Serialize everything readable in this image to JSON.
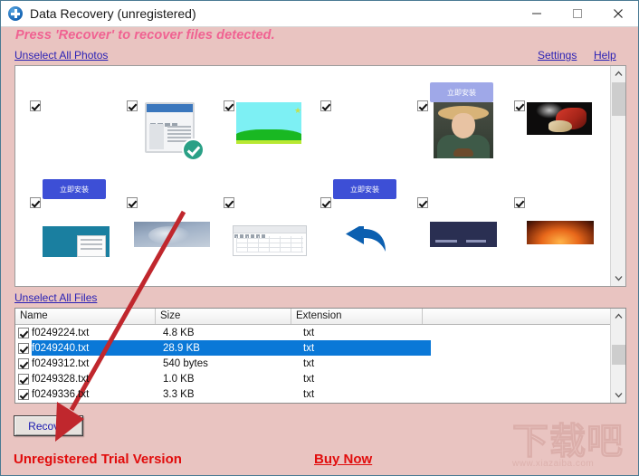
{
  "window": {
    "title": "Data Recovery (unregistered)",
    "icon": "app-plus-circle-icon",
    "minimize_label": "–",
    "maximize_label": "□",
    "close_label": "✕"
  },
  "banner": {
    "message": "Press 'Recover' to recover files detected."
  },
  "links": {
    "unselect_photos": "Unselect All Photos",
    "unselect_files": "Unselect All Files",
    "settings": "Settings",
    "help": "Help"
  },
  "photo_panel": {
    "thumbnails": [
      {
        "art": "dialog",
        "checked": true,
        "label": "windows-dialog-thumbnail"
      },
      {
        "art": "blank",
        "checked": true,
        "label": "blank-thumbnail"
      },
      {
        "art": "blank",
        "checked": true,
        "label": "blank-thumbnail"
      },
      {
        "art": "blank",
        "checked": true,
        "label": "blank-thumbnail"
      },
      {
        "art": "btn-cn",
        "checked": true,
        "label": "install-now-banner-thumbnail",
        "text": "立即安装"
      },
      {
        "art": "lock",
        "checked": true,
        "label": "security-lock-thumbnail"
      },
      {
        "art": "btn-cn2",
        "checked": true,
        "label": "install-now-button-thumbnail",
        "text": "立即安装"
      },
      {
        "art": "browser",
        "checked": true,
        "label": "browser-verified-thumbnail"
      },
      {
        "art": "field",
        "checked": true,
        "label": "green-field-thumbnail"
      },
      {
        "art": "btn-cn2",
        "checked": true,
        "label": "install-now-button-thumbnail",
        "text": "立即安装"
      },
      {
        "art": "person",
        "checked": true,
        "label": "farmer-portrait-thumbnail"
      },
      {
        "art": "food",
        "checked": true,
        "label": "grilled-food-thumbnail"
      },
      {
        "art": "card-teal",
        "checked": false,
        "label": "teal-card-thumbnail"
      },
      {
        "art": "clouds",
        "checked": false,
        "label": "cloudy-sky-thumbnail"
      },
      {
        "art": "sheet",
        "checked": false,
        "label": "spreadsheet-thumbnail"
      },
      {
        "art": "arrow",
        "checked": false,
        "label": "blue-back-arrow-thumbnail"
      },
      {
        "art": "dark",
        "checked": false,
        "label": "dark-banner-thumbnail"
      },
      {
        "art": "fire",
        "checked": false,
        "label": "fire-thumbnail"
      }
    ]
  },
  "file_table": {
    "columns": [
      "Name",
      "Size",
      "Extension",
      ""
    ],
    "rows": [
      {
        "checked": true,
        "name": "f0249224.txt",
        "size": "4.8 KB",
        "extension": "txt",
        "selected": false
      },
      {
        "checked": true,
        "name": "f0249240.txt",
        "size": "28.9 KB",
        "extension": "txt",
        "selected": true
      },
      {
        "checked": true,
        "name": "f0249312.txt",
        "size": "540 bytes",
        "extension": "txt",
        "selected": false
      },
      {
        "checked": true,
        "name": "f0249328.txt",
        "size": "1.0 KB",
        "extension": "txt",
        "selected": false
      },
      {
        "checked": true,
        "name": "f0249336.txt",
        "size": "3.3 KB",
        "extension": "txt",
        "selected": false
      }
    ]
  },
  "actions": {
    "recover": "Recover"
  },
  "footer": {
    "trial": "Unregistered Trial Version",
    "buy_now": "Buy Now"
  },
  "watermark": {
    "logo": "下载吧",
    "url": "www.xiazaiba.com"
  },
  "colors": {
    "banner_background": "#e9c4c1",
    "banner_text": "#f06292",
    "link": "#2b22b5",
    "selection": "#0a78d7",
    "trial_red": "#e10c0c",
    "annotation_arrow": "#c0272d"
  }
}
